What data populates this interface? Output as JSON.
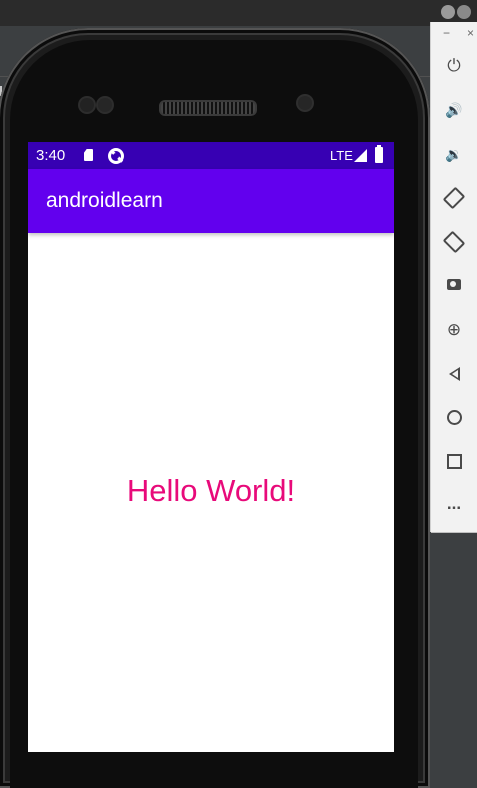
{
  "status_bar": {
    "time": "3:40",
    "network": "LTE",
    "icons": [
      "sd-card-icon",
      "sync-icon",
      "signal-icon",
      "battery-icon"
    ]
  },
  "app_bar": {
    "title": "androidlearn"
  },
  "content": {
    "text": "Hello World!",
    "text_color": "#e80a7a"
  },
  "colors": {
    "status_bar": "#3700b3",
    "app_bar": "#6200ee",
    "panel": "#f2f2f2"
  },
  "tool_panel": {
    "window_controls": {
      "minimize": "−",
      "close": "×"
    },
    "buttons": [
      "power-icon",
      "volume-up-icon",
      "volume-down-icon",
      "rotate-left-icon",
      "rotate-right-icon",
      "camera-icon",
      "zoom-icon",
      "back-icon",
      "home-icon",
      "overview-icon",
      "more-icon"
    ],
    "glyphs": {
      "power": "⏻",
      "volume_up": "🔊",
      "volume_down": "🔉",
      "zoom": "⊕",
      "more": "..."
    }
  }
}
